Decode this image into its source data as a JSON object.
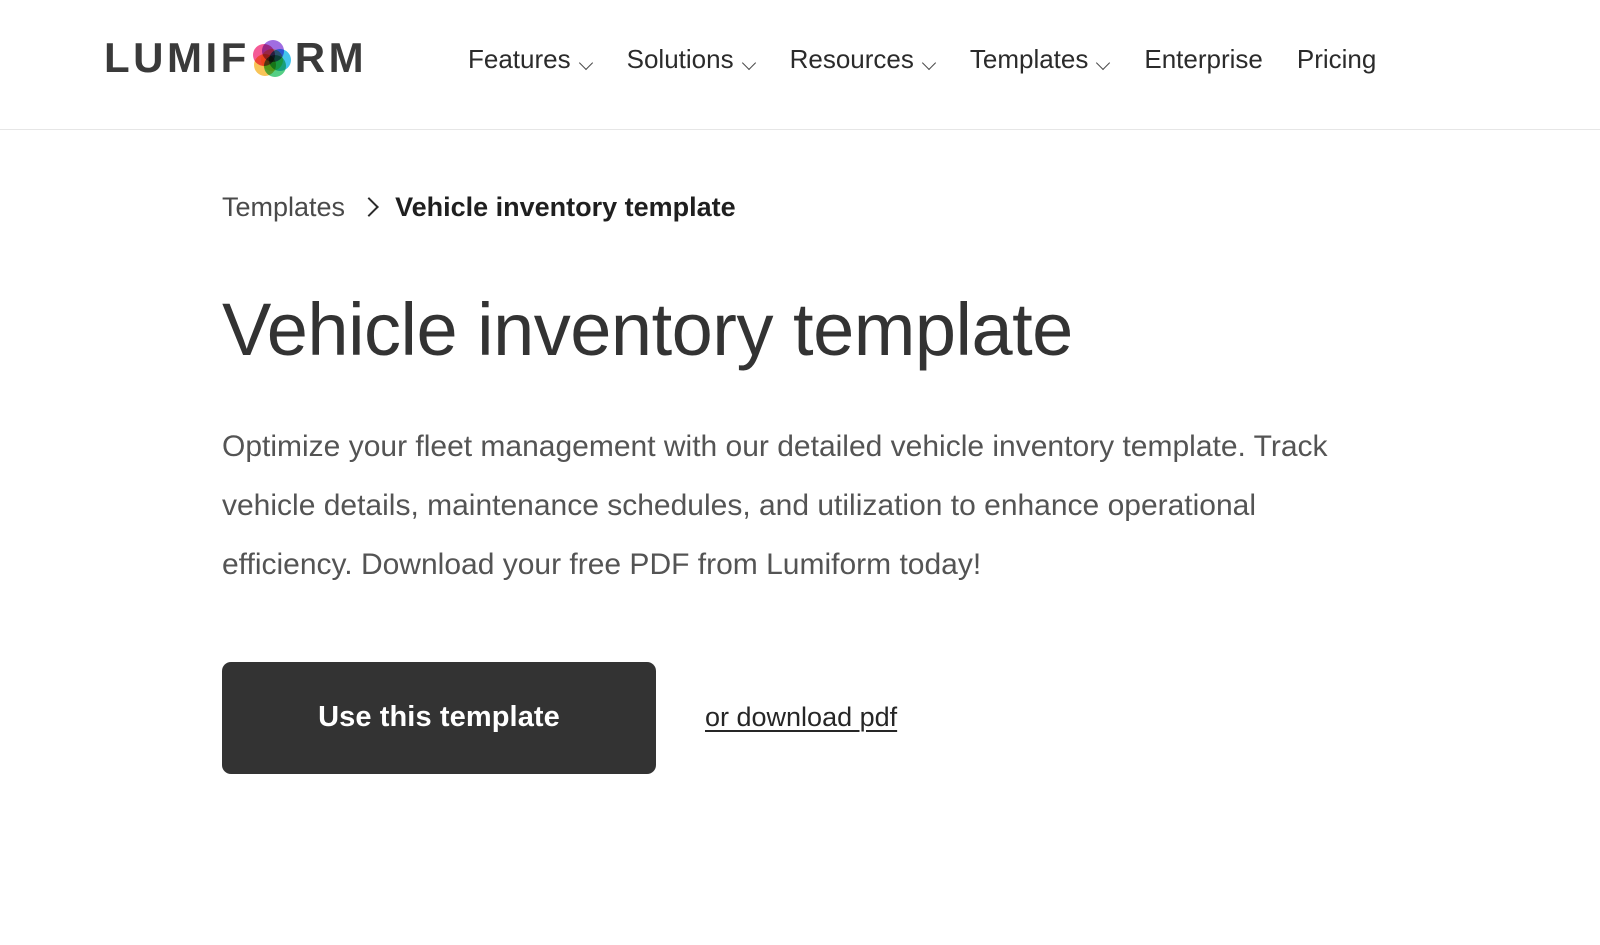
{
  "header": {
    "logo": {
      "text_before": "LUMIF",
      "text_after": "RM",
      "mark_icon": "lumiform-circles-logo-icon",
      "alt": "LUMIFORM"
    },
    "nav": [
      {
        "label": "Features",
        "has_dropdown": true,
        "icon": "chevron-down-icon"
      },
      {
        "label": "Solutions",
        "has_dropdown": true,
        "icon": "chevron-down-icon"
      },
      {
        "label": "Resources",
        "has_dropdown": true,
        "icon": "chevron-down-icon"
      },
      {
        "label": "Templates",
        "has_dropdown": true,
        "icon": "chevron-down-icon"
      },
      {
        "label": "Enterprise",
        "has_dropdown": false,
        "icon": ""
      },
      {
        "label": "Pricing",
        "has_dropdown": false,
        "icon": ""
      }
    ]
  },
  "breadcrumb": {
    "parent": "Templates",
    "separator_icon": "chevron-right-icon",
    "current": "Vehicle inventory template"
  },
  "main": {
    "title": "Vehicle inventory template",
    "description": "Optimize your fleet management with our detailed vehicle inventory template. Track vehicle details, maintenance schedules, and utilization to enhance operational efficiency. Download your free PDF from Lumiform today!",
    "cta": {
      "primary_label": "Use this template",
      "secondary_label": "or download pdf"
    }
  },
  "colors": {
    "page_background": "#ffffff",
    "heading_text": "#333333",
    "body_text": "#545454",
    "nav_text": "#2b2b2b",
    "button_background": "#333333",
    "button_text": "#ffffff",
    "header_border": "#e6e6e6",
    "logo_text": "#3a3a3a"
  }
}
